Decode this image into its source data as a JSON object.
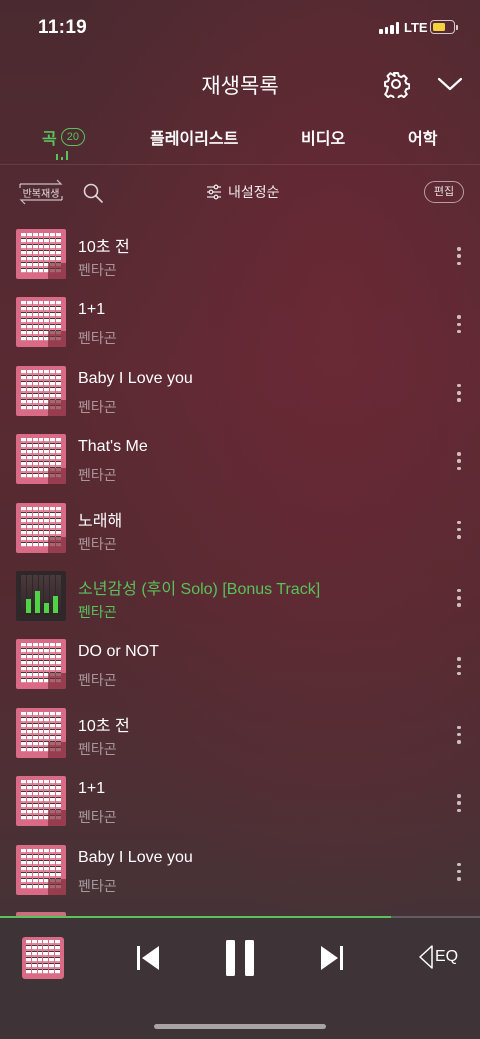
{
  "status_bar": {
    "time": "11:19",
    "network": "LTE",
    "battery_color": "#f3d23b"
  },
  "header": {
    "title": "재생목록",
    "settings_icon": "gear-icon",
    "collapse_icon": "chevron-down-icon"
  },
  "tabs": {
    "song_label": "곡",
    "song_count": "20",
    "playlist_label": "플레이리스트",
    "video_label": "비디오",
    "language_label": "어학",
    "active_color": "#58c25b"
  },
  "toolbar": {
    "repeat_label": "반복재생",
    "sort_label": "내설정순",
    "edit_label": "편집"
  },
  "tracks": [
    {
      "title": "10초 전",
      "artist": "펜타곤"
    },
    {
      "title": "1+1",
      "artist": "펜타곤"
    },
    {
      "title": "Baby I Love you",
      "artist": "펜타곤"
    },
    {
      "title": "That's Me",
      "artist": "펜타곤"
    },
    {
      "title": "노래해",
      "artist": "펜타곤"
    },
    {
      "title": "소년감성 (후이 Solo) [Bonus Track]",
      "artist": "펜타곤",
      "now_playing": true
    },
    {
      "title": "DO or NOT",
      "artist": "펜타곤"
    },
    {
      "title": "10초 전",
      "artist": "펜타곤"
    },
    {
      "title": "1+1",
      "artist": "펜타곤"
    },
    {
      "title": "Baby I Love you",
      "artist": "펜타곤"
    }
  ],
  "player": {
    "progress": 0.815,
    "eq_label": "EQ",
    "accent": "#58c25b"
  }
}
